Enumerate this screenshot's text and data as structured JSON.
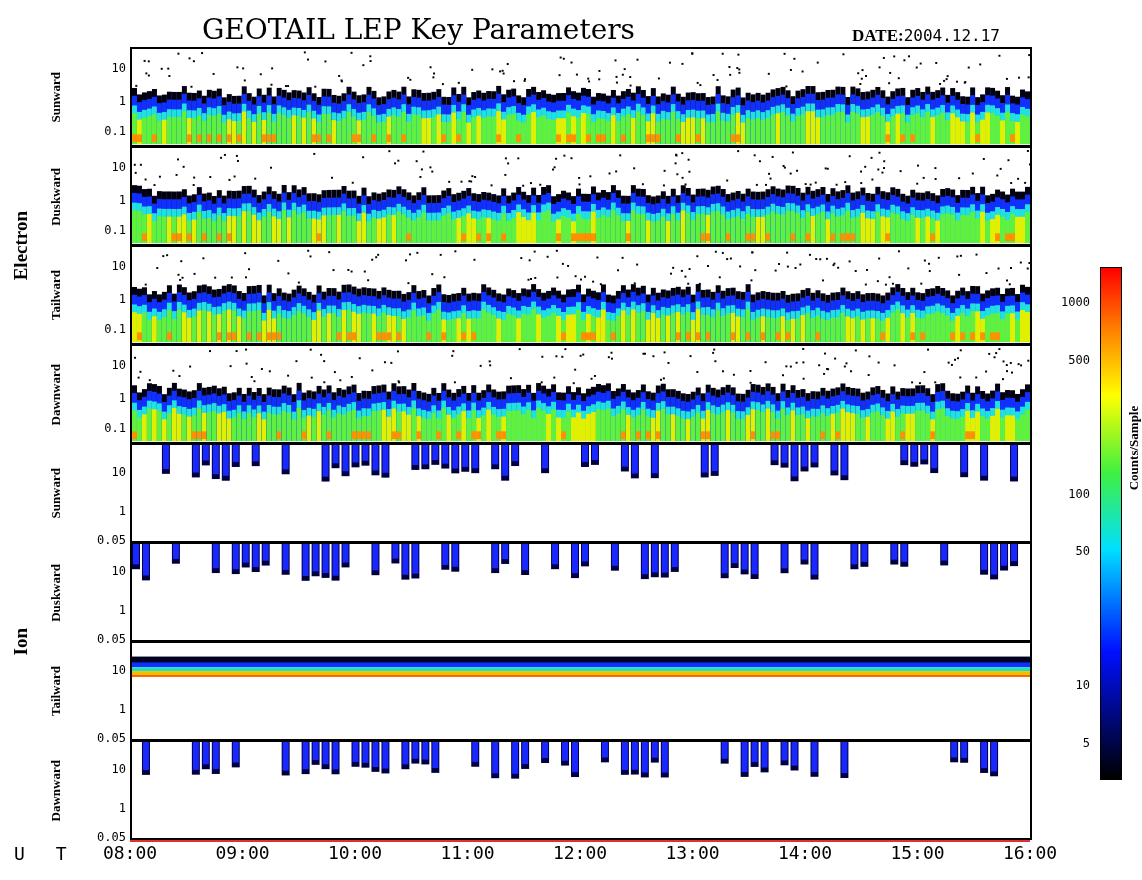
{
  "title": "GEOTAIL LEP Key Parameters",
  "date": {
    "label": "DATE:",
    "value": "2004.12.17"
  },
  "groups": [
    {
      "name": "Electron",
      "panels": [
        {
          "label": "Sunward",
          "kind": "electron",
          "yticks": [
            "10",
            "1",
            "0.1"
          ]
        },
        {
          "label": "Duskward",
          "kind": "electron",
          "yticks": [
            "10",
            "1",
            "0.1"
          ]
        },
        {
          "label": "Tailward",
          "kind": "electron",
          "yticks": [
            "10",
            "1",
            "0.1"
          ]
        },
        {
          "label": "Dawnward",
          "kind": "electron",
          "yticks": [
            "10",
            "1",
            "0.1"
          ]
        }
      ]
    },
    {
      "name": "Ion",
      "panels": [
        {
          "label": "Sunward",
          "kind": "ion",
          "yticks": [
            "10",
            "1",
            "0.05"
          ]
        },
        {
          "label": "Duskward",
          "kind": "ion",
          "yticks": [
            "10",
            "1",
            "0.05"
          ]
        },
        {
          "label": "Tailward",
          "kind": "ion_band",
          "yticks": [
            "10",
            "1",
            "0.05"
          ]
        },
        {
          "label": "Dawnward",
          "kind": "ion",
          "yticks": [
            "10",
            "1",
            "0.05"
          ]
        }
      ]
    }
  ],
  "x_axis": {
    "label": "U T",
    "ticks": [
      "08:00",
      "09:00",
      "10:00",
      "11:00",
      "12:00",
      "13:00",
      "14:00",
      "15:00",
      "16:00"
    ]
  },
  "colorbar": {
    "title": "Counts/Sample",
    "ticks": [
      "1000",
      "500",
      "100",
      "50",
      "10",
      "5"
    ]
  }
}
